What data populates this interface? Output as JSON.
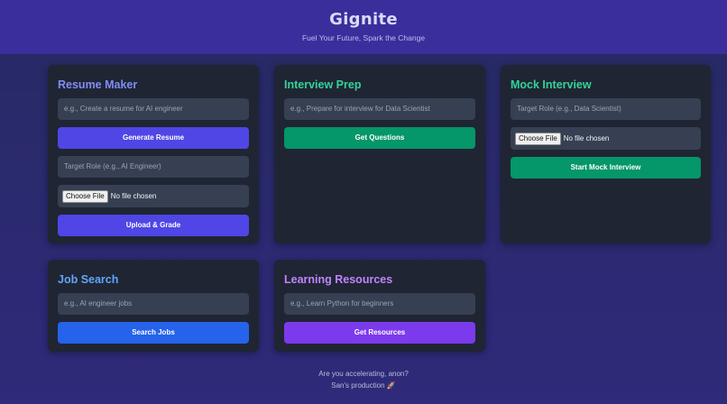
{
  "header": {
    "title": "Gignite",
    "tagline": "Fuel Your Future, Spark the Change"
  },
  "resume_maker": {
    "title": "Resume Maker",
    "prompt_placeholder": "e.g., Create a resume for AI engineer",
    "generate_label": "Generate Resume",
    "role_placeholder": "Target Role (e.g., AI Engineer)",
    "choose_file_label": "Choose File",
    "file_status": "No file chosen",
    "upload_label": "Upload & Grade"
  },
  "interview_prep": {
    "title": "Interview Prep",
    "prompt_placeholder": "e.g., Prepare for interview for Data Scientist",
    "get_questions_label": "Get Questions"
  },
  "mock_interview": {
    "title": "Mock Interview",
    "role_placeholder": "Target Role (e.g., Data Scientist)",
    "choose_file_label": "Choose File",
    "file_status": "No file chosen",
    "start_label": "Start Mock Interview"
  },
  "job_search": {
    "title": "Job Search",
    "prompt_placeholder": "e.g., AI engineer jobs",
    "search_label": "Search Jobs"
  },
  "learning_resources": {
    "title": "Learning Resources",
    "prompt_placeholder": "e.g., Learn Python for beginners",
    "get_resources_label": "Get Resources"
  },
  "footer": {
    "line1": "Are you accelerating, anon?",
    "line2": "San's production 🚀"
  },
  "colors": {
    "resume_title": "#818cf8",
    "interview_title": "#34d399",
    "mock_title": "#34d399",
    "job_title": "#60a5fa",
    "learning_title": "#c084fc",
    "indigo_button": "#4f46e5",
    "green_button": "#059669",
    "blue_button": "#2563eb",
    "purple_button": "#7c3aed"
  }
}
